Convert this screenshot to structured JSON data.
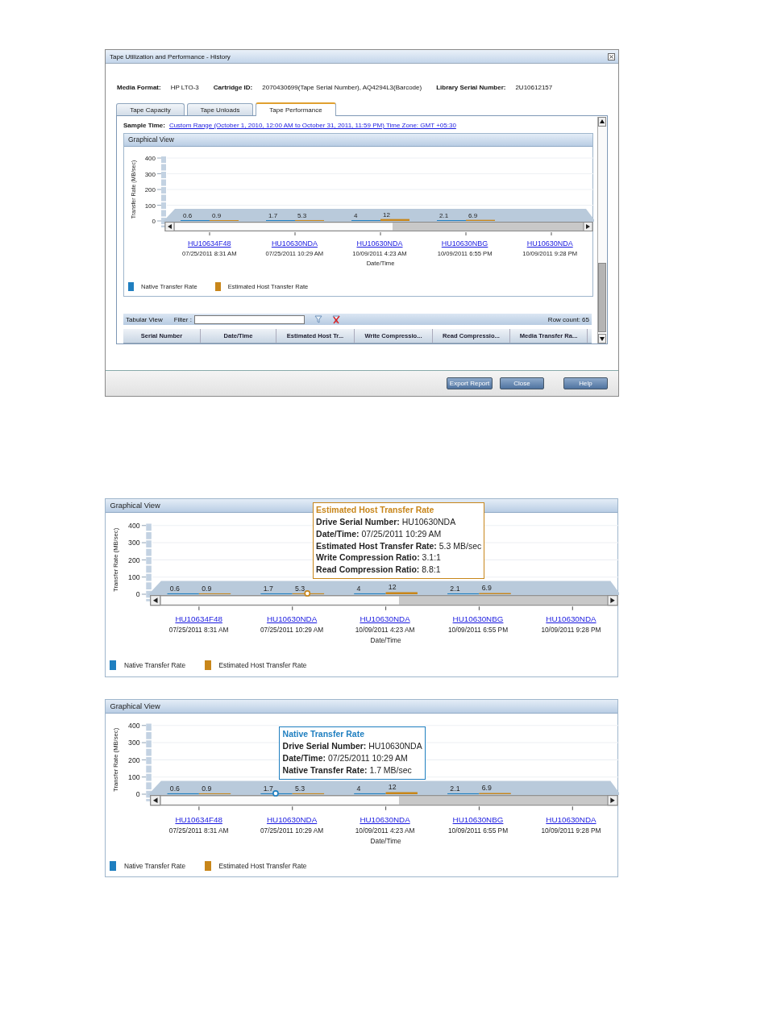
{
  "dialog": {
    "title": "Tape Utilization and Performance - History",
    "info": [
      {
        "label": "Media Format:",
        "value": "HP LTO-3"
      },
      {
        "label": "Cartridge ID:",
        "value": "2070430699(Tape Serial Number), AQ4294L3(Barcode)"
      },
      {
        "label": "Library Serial Number:",
        "value": "2U10612157"
      }
    ],
    "tabs": [
      {
        "label": "Tape Capacity",
        "selected": false
      },
      {
        "label": "Tape Unloads",
        "selected": false
      },
      {
        "label": "Tape Performance",
        "selected": true
      }
    ],
    "sample_time": {
      "label": "Sample Time:",
      "value": "Custom Range (October 1, 2010, 12:00 AM to October 31, 2011, 11:59 PM) Time Zone: GMT +05:30"
    },
    "graphical_view": {
      "title": "Graphical View",
      "x_links": [
        {
          "text": "HU10634F48"
        },
        {
          "text": "HU10630NDA"
        },
        {
          "text": "HU10630NDA"
        },
        {
          "text": "HU10630NBG"
        },
        {
          "text": "HU10630NDA"
        }
      ],
      "chart_data": {
        "type": "bar",
        "xlabel": "Date/Time",
        "ylabel": "Transfer Rate (MB/sec)",
        "categories": [
          "07/25/2011 8:31 AM",
          "07/25/2011 10:29 AM",
          "10/09/2011 4:23 AM",
          "10/09/2011 6:55 PM",
          "10/09/2011 9:28 PM"
        ],
        "series": [
          {
            "name": "Native Transfer Rate",
            "color": "#1f7fc0",
            "values": [
              0.6,
              1.7,
              4,
              2.1,
              null
            ]
          },
          {
            "name": "Estimated Host Transfer Rate",
            "color": "#c8861a",
            "values": [
              0.9,
              5.3,
              12,
              6.9,
              null
            ]
          }
        ],
        "ylim": [
          0,
          400
        ],
        "yticks": [
          0,
          100,
          200,
          300,
          400
        ],
        "grid": true,
        "data_labels": true
      }
    },
    "tabular_view": {
      "title": "Tabular View",
      "filter_label": "Filter :",
      "row_count": "Row count: 65",
      "columns": [
        "Serial Number",
        "Date/Time",
        "Estimated Host Tr...",
        "Write Compressio...",
        "Read Compressio...",
        "Media Transfer Ra..."
      ]
    },
    "buttons": [
      "Export Report",
      "Close",
      "Help"
    ]
  },
  "panels": [
    {
      "title": "Graphical View",
      "x_links": [
        {
          "text": "HU10634F48",
          "hovered": false
        },
        {
          "text": "HU10630NDA",
          "hovered": true
        },
        {
          "text": "HU10630NDA",
          "hovered": false
        },
        {
          "text": "HU10630NBG",
          "hovered": false
        },
        {
          "text": "HU10630NDA",
          "hovered": false
        }
      ],
      "chart_data": {
        "type": "bar",
        "xlabel": "Date/Time",
        "ylabel": "Transfer Rate (MB/sec)",
        "categories": [
          "07/25/2011 8:31 AM",
          "07/25/2011 10:29 AM",
          "10/09/2011 4:23 AM",
          "10/09/2011 6:55 PM",
          "10/09/2011 9:28 PM"
        ],
        "series": [
          {
            "name": "Native Transfer Rate",
            "color": "#1f7fc0",
            "values": [
              0.6,
              1.7,
              4,
              2.1,
              null
            ]
          },
          {
            "name": "Estimated Host Transfer Rate",
            "color": "#c8861a",
            "values": [
              0.9,
              5.3,
              12,
              6.9,
              null
            ]
          }
        ],
        "ylim": [
          0,
          400
        ],
        "yticks": [
          0,
          100,
          200,
          300,
          400
        ],
        "grid": true,
        "data_labels": true
      },
      "tooltip": {
        "kind": "estimated",
        "title": "Estimated Host Transfer Rate",
        "lines": [
          "**Drive Serial Number:** HU10630NDA",
          "**Date/Time:** 07/25/2011 10:29 AM",
          "**Estimated Host Transfer Rate:** 5.3 MB/sec",
          "**Write Compression Ratio:** 3.1:1",
          "**Read Compression Ratio:** 8.8:1"
        ]
      }
    },
    {
      "title": "Graphical View",
      "x_links": [
        {
          "text": "HU10634F48",
          "hovered": false
        },
        {
          "text": "HU10630NDA",
          "hovered": true
        },
        {
          "text": "HU10630NDA",
          "hovered": false
        },
        {
          "text": "HU10630NBG",
          "hovered": false
        },
        {
          "text": "HU10630NDA",
          "hovered": false
        }
      ],
      "chart_data": {
        "type": "bar",
        "xlabel": "Date/Time",
        "ylabel": "Transfer Rate (MB/sec)",
        "categories": [
          "07/25/2011 8:31 AM",
          "07/25/2011 10:29 AM",
          "10/09/2011 4:23 AM",
          "10/09/2011 6:55 PM",
          "10/09/2011 9:28 PM"
        ],
        "series": [
          {
            "name": "Native Transfer Rate",
            "color": "#1f7fc0",
            "values": [
              0.6,
              1.7,
              4,
              2.1,
              null
            ]
          },
          {
            "name": "Estimated Host Transfer Rate",
            "color": "#c8861a",
            "values": [
              0.9,
              5.3,
              12,
              6.9,
              null
            ]
          }
        ],
        "ylim": [
          0,
          400
        ],
        "yticks": [
          0,
          100,
          200,
          300,
          400
        ],
        "grid": true,
        "data_labels": true
      },
      "tooltip": {
        "kind": "native",
        "title": "Native Transfer Rate",
        "lines": [
          "**Drive Serial Number:** HU10630NDA",
          "**Date/Time:** 07/25/2011 10:29 AM",
          "**Native Transfer Rate:** 1.7 MB/sec"
        ]
      }
    }
  ]
}
